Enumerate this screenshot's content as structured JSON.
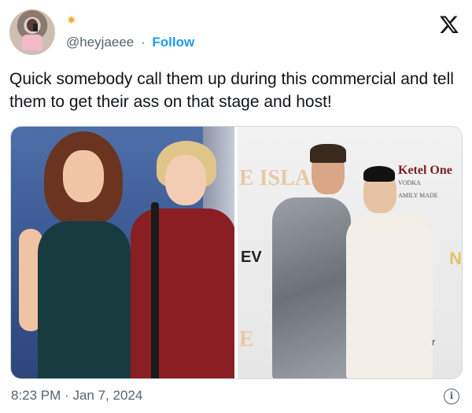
{
  "tweet": {
    "handle": "@heyjaeee",
    "separator": "·",
    "follow_label": "Follow",
    "text": "Quick somebody call them up during this commercial and tell them to get their ass on that stage and host!",
    "time": "8:23 PM",
    "date": "Jan 7, 2024"
  },
  "media": {
    "right_photo_signage": {
      "wall_text_top": "E ISLA",
      "wall_text_bottom": "E",
      "event_mark": "EV",
      "brand_name": "Ketel One",
      "brand_sub": "VODKA",
      "brand_tagline": "AMILY MADE",
      "corner_text": "LET",
      "right_edge_text": "N"
    }
  },
  "icons": {
    "x_logo": "x-logo-icon",
    "star": "star-icon",
    "info": "info-icon"
  },
  "colors": {
    "follow": "#1d9bf0",
    "muted": "#536471",
    "text": "#0f1419",
    "star": "#f5a623"
  }
}
